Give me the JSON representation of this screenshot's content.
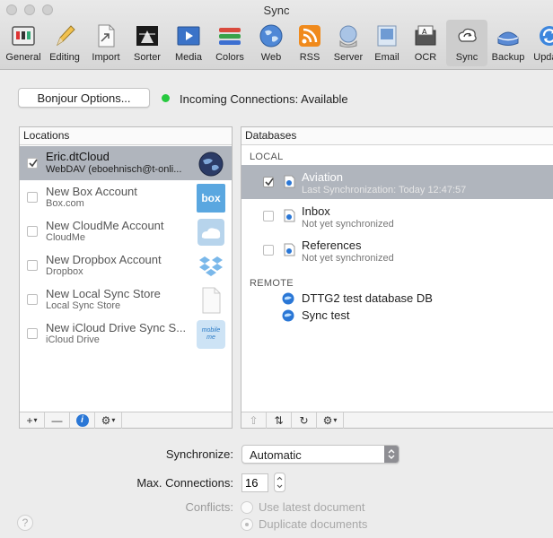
{
  "window": {
    "title": "Sync"
  },
  "toolbar": [
    {
      "label": "General",
      "icon": "general-icon"
    },
    {
      "label": "Editing",
      "icon": "pencil-icon"
    },
    {
      "label": "Import",
      "icon": "import-icon"
    },
    {
      "label": "Sorter",
      "icon": "sorter-icon"
    },
    {
      "label": "Media",
      "icon": "media-icon"
    },
    {
      "label": "Colors",
      "icon": "colors-icon"
    },
    {
      "label": "Web",
      "icon": "globe-icon"
    },
    {
      "label": "RSS",
      "icon": "rss-icon"
    },
    {
      "label": "Server",
      "icon": "server-icon"
    },
    {
      "label": "Email",
      "icon": "email-icon"
    },
    {
      "label": "OCR",
      "icon": "ocr-icon"
    },
    {
      "label": "Sync",
      "icon": "sync-icon",
      "active": true
    },
    {
      "label": "Backup",
      "icon": "backup-icon"
    },
    {
      "label": "Update",
      "icon": "update-icon"
    }
  ],
  "bonjour": {
    "button": "Bonjour Options...",
    "status": "Incoming Connections: Available",
    "status_color": "#27c93f"
  },
  "locations": {
    "header": "Locations",
    "items": [
      {
        "title": "Eric.dtCloud",
        "subtitle": "WebDAV (eboehnisch@t-onli...",
        "checked": true,
        "selected": true,
        "icon": "cloud-globe-icon"
      },
      {
        "title": "New Box Account",
        "subtitle": "Box.com",
        "icon": "box-icon",
        "icon_text": "box"
      },
      {
        "title": "New CloudMe Account",
        "subtitle": "CloudMe",
        "icon": "cloudme-icon"
      },
      {
        "title": "New Dropbox Account",
        "subtitle": "Dropbox",
        "icon": "dropbox-icon"
      },
      {
        "title": "New Local Sync Store",
        "subtitle": "Local Sync Store",
        "icon": "document-icon"
      },
      {
        "title": "New iCloud Drive Sync S...",
        "subtitle": "iCloud Drive",
        "icon": "icloud-icon",
        "icon_text": "mobile me"
      }
    ],
    "footer": {
      "add": "+",
      "remove": "—",
      "info": "i",
      "gear": "⚙"
    }
  },
  "databases": {
    "header": "Databases",
    "local_label": "LOCAL",
    "local": [
      {
        "title": "Aviation",
        "subtitle": "Last Synchronization: Today 12:47:57",
        "checked": true,
        "selected": true
      },
      {
        "title": "Inbox",
        "subtitle": "Not yet synchronized"
      },
      {
        "title": "References",
        "subtitle": "Not yet synchronized"
      }
    ],
    "remote_label": "REMOTE",
    "remote": [
      {
        "title": "DTTG2 test database DB"
      },
      {
        "title": "Sync test"
      }
    ],
    "footer": {
      "share": "⇧",
      "sync": "⇅",
      "refresh": "↻",
      "gear": "⚙"
    }
  },
  "settings": {
    "synchronize_label": "Synchronize:",
    "synchronize_value": "Automatic",
    "max_connections_label": "Max. Connections:",
    "max_connections_value": "16",
    "conflicts_label": "Conflicts:",
    "conflict_options": [
      "Use latest document",
      "Duplicate documents"
    ],
    "conflict_selected": 1
  },
  "help": "?",
  "colors": {
    "selection": "#b0b5bd",
    "accent_blue": "#2a77d6"
  }
}
